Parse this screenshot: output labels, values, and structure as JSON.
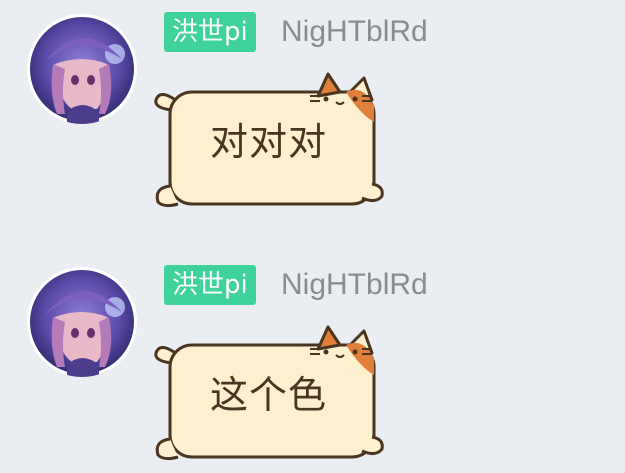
{
  "messages": [
    {
      "sender": {
        "title_badge": "洪世pi",
        "nickname": "NigHTblRd"
      },
      "text": "对对对"
    },
    {
      "sender": {
        "title_badge": "洪世pi",
        "nickname": "NigHTblRd"
      },
      "text": "这个色"
    }
  ],
  "colors": {
    "background": "#eaedf1",
    "title_badge": "#3fd29b",
    "nickname": "#8a8c90",
    "bubble_fill": "#fdf0cf",
    "bubble_outline": "#4a3520",
    "cat_ear_orange": "#e0803a"
  }
}
